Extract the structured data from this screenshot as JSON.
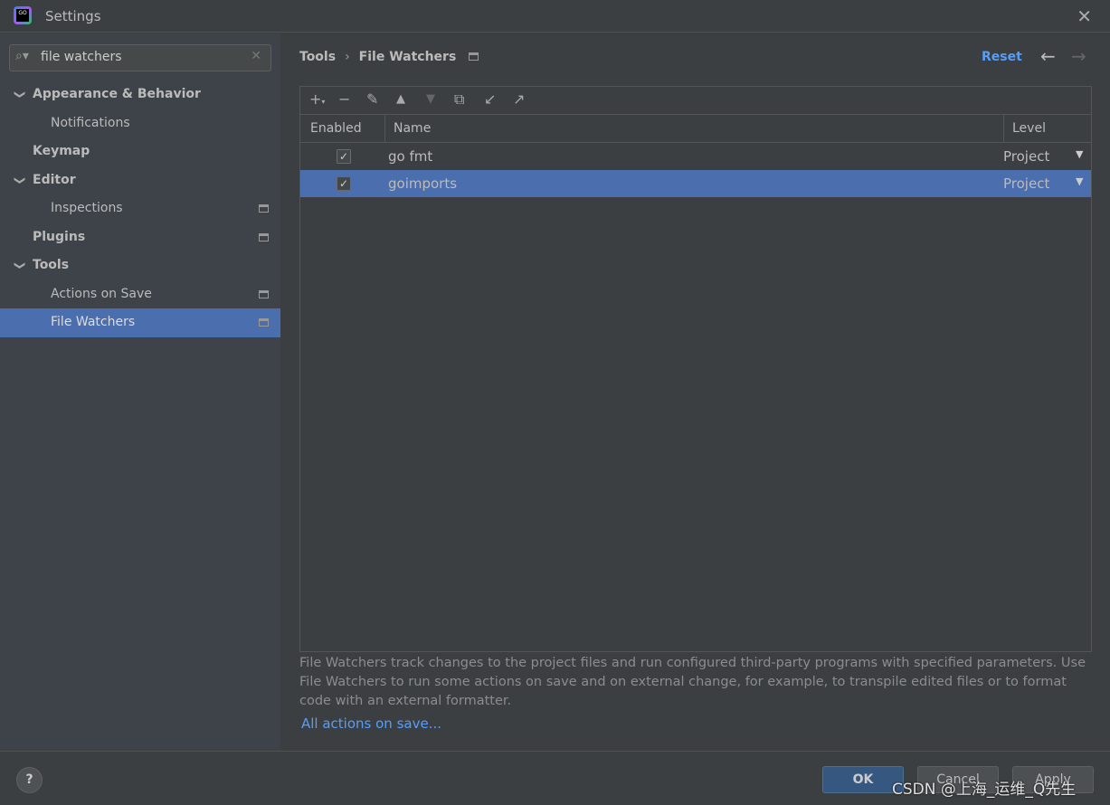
{
  "window": {
    "title": "Settings"
  },
  "search": {
    "value": "file watchers"
  },
  "sidebar": {
    "items": [
      {
        "label": "Appearance & Behavior",
        "level": 0,
        "expanded": true
      },
      {
        "label": "Notifications",
        "level": 1
      },
      {
        "label": "Keymap",
        "level": 0
      },
      {
        "label": "Editor",
        "level": 0,
        "expanded": true
      },
      {
        "label": "Inspections",
        "level": 1,
        "project": true
      },
      {
        "label": "Plugins",
        "level": 0,
        "project": true
      },
      {
        "label": "Tools",
        "level": 0,
        "expanded": true
      },
      {
        "label": "Actions on Save",
        "level": 1,
        "project": true
      },
      {
        "label": "File Watchers",
        "level": 1,
        "project": true,
        "selected": true
      }
    ]
  },
  "breadcrumb": {
    "parent": "Tools",
    "current": "File Watchers"
  },
  "header": {
    "reset": "Reset"
  },
  "table": {
    "columns": [
      "Enabled",
      "Name",
      "Level"
    ],
    "rows": [
      {
        "enabled": true,
        "name": "go fmt",
        "level": "Project"
      },
      {
        "enabled": true,
        "name": "goimports",
        "level": "Project",
        "selected": true
      }
    ]
  },
  "description": "File Watchers track changes to the project files and run configured third-party programs with specified parameters. Use File Watchers to run some actions on save and on external change, for example, to transpile edited files or to format code with an external formatter.",
  "link": "All actions on save...",
  "footer": {
    "help": "?",
    "ok": "OK",
    "cancel": "Cancel",
    "apply": "Apply"
  },
  "watermark": "CSDN @上海_运维_Q先生",
  "colors": {
    "selection": "#4b6eaf",
    "link": "#589df6",
    "ok": "#365880"
  }
}
